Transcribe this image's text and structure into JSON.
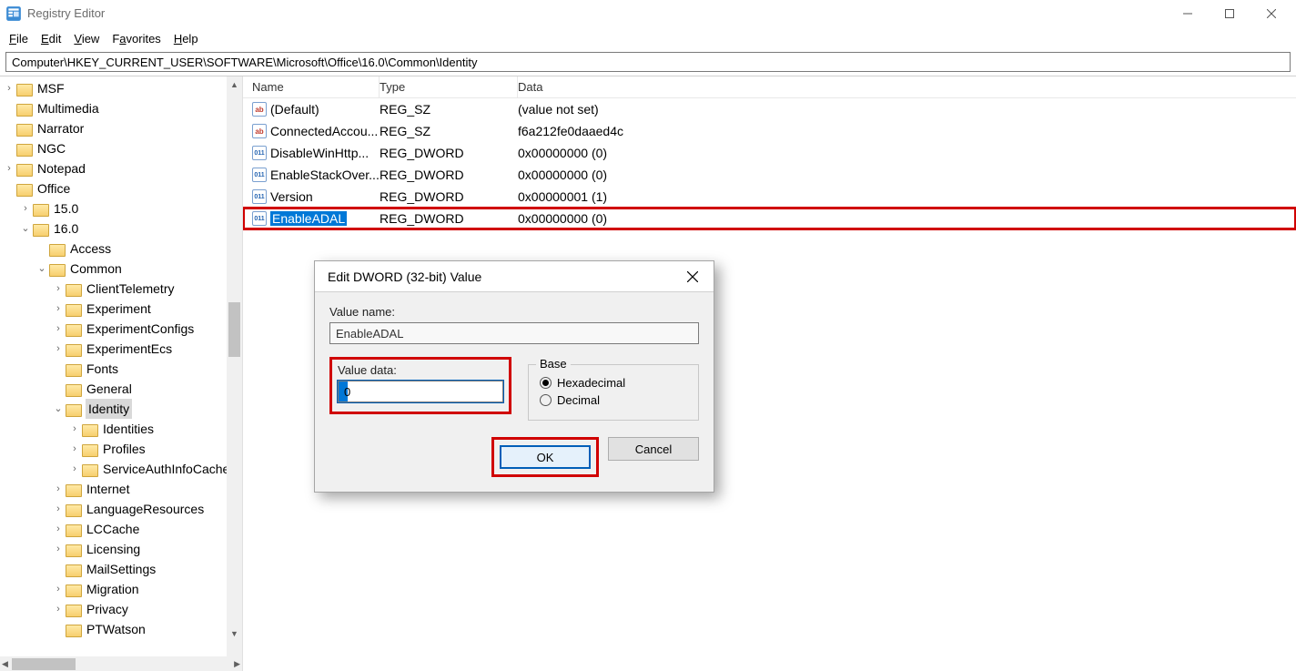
{
  "window": {
    "title": "Registry Editor"
  },
  "menu": {
    "file": "File",
    "edit": "Edit",
    "view": "View",
    "favorites": "Favorites",
    "help": "Help"
  },
  "address": "Computer\\HKEY_CURRENT_USER\\SOFTWARE\\Microsoft\\Office\\16.0\\Common\\Identity",
  "tree": [
    {
      "depth": 0,
      "chev": "closed",
      "label": "MSF"
    },
    {
      "depth": 0,
      "chev": "none",
      "label": "Multimedia"
    },
    {
      "depth": 0,
      "chev": "none",
      "label": "Narrator"
    },
    {
      "depth": 0,
      "chev": "none",
      "label": "NGC"
    },
    {
      "depth": 0,
      "chev": "closed",
      "label": "Notepad"
    },
    {
      "depth": 0,
      "chev": "none",
      "label": "Office"
    },
    {
      "depth": 1,
      "chev": "closed",
      "label": "15.0"
    },
    {
      "depth": 1,
      "chev": "open",
      "label": "16.0"
    },
    {
      "depth": 2,
      "chev": "none",
      "label": "Access"
    },
    {
      "depth": 2,
      "chev": "open",
      "label": "Common"
    },
    {
      "depth": 3,
      "chev": "closed",
      "label": "ClientTelemetry"
    },
    {
      "depth": 3,
      "chev": "closed",
      "label": "Experiment"
    },
    {
      "depth": 3,
      "chev": "closed",
      "label": "ExperimentConfigs"
    },
    {
      "depth": 3,
      "chev": "closed",
      "label": "ExperimentEcs"
    },
    {
      "depth": 3,
      "chev": "none",
      "label": "Fonts"
    },
    {
      "depth": 3,
      "chev": "none",
      "label": "General"
    },
    {
      "depth": 3,
      "chev": "open",
      "label": "Identity",
      "selected": true
    },
    {
      "depth": 4,
      "chev": "closed",
      "label": "Identities"
    },
    {
      "depth": 4,
      "chev": "closed",
      "label": "Profiles"
    },
    {
      "depth": 4,
      "chev": "closed",
      "label": "ServiceAuthInfoCache"
    },
    {
      "depth": 3,
      "chev": "closed",
      "label": "Internet"
    },
    {
      "depth": 3,
      "chev": "closed",
      "label": "LanguageResources"
    },
    {
      "depth": 3,
      "chev": "closed",
      "label": "LCCache"
    },
    {
      "depth": 3,
      "chev": "closed",
      "label": "Licensing"
    },
    {
      "depth": 3,
      "chev": "none",
      "label": "MailSettings"
    },
    {
      "depth": 3,
      "chev": "closed",
      "label": "Migration"
    },
    {
      "depth": 3,
      "chev": "closed",
      "label": "Privacy"
    },
    {
      "depth": 3,
      "chev": "none",
      "label": "PTWatson"
    }
  ],
  "columns": {
    "name": "Name",
    "type": "Type",
    "data": "Data"
  },
  "rows": [
    {
      "icon": "sz",
      "name": "(Default)",
      "type": "REG_SZ",
      "data": "(value not set)"
    },
    {
      "icon": "sz",
      "name": "ConnectedAccou...",
      "type": "REG_SZ",
      "data": "f6a212fe0daaed4c"
    },
    {
      "icon": "dw",
      "name": "DisableWinHttp...",
      "type": "REG_DWORD",
      "data": "0x00000000 (0)"
    },
    {
      "icon": "dw",
      "name": "EnableStackOver...",
      "type": "REG_DWORD",
      "data": "0x00000000 (0)"
    },
    {
      "icon": "dw",
      "name": "Version",
      "type": "REG_DWORD",
      "data": "0x00000001 (1)"
    },
    {
      "icon": "dw",
      "name": "EnableADAL",
      "type": "REG_DWORD",
      "data": "0x00000000 (0)",
      "highlight": true,
      "selected": true
    }
  ],
  "dialog": {
    "title": "Edit DWORD (32-bit) Value",
    "valueNameLabel": "Value name:",
    "valueName": "EnableADAL",
    "valueDataLabel": "Value data:",
    "valueData": "0",
    "baseLabel": "Base",
    "hex": "Hexadecimal",
    "dec": "Decimal",
    "ok": "OK",
    "cancel": "Cancel"
  }
}
